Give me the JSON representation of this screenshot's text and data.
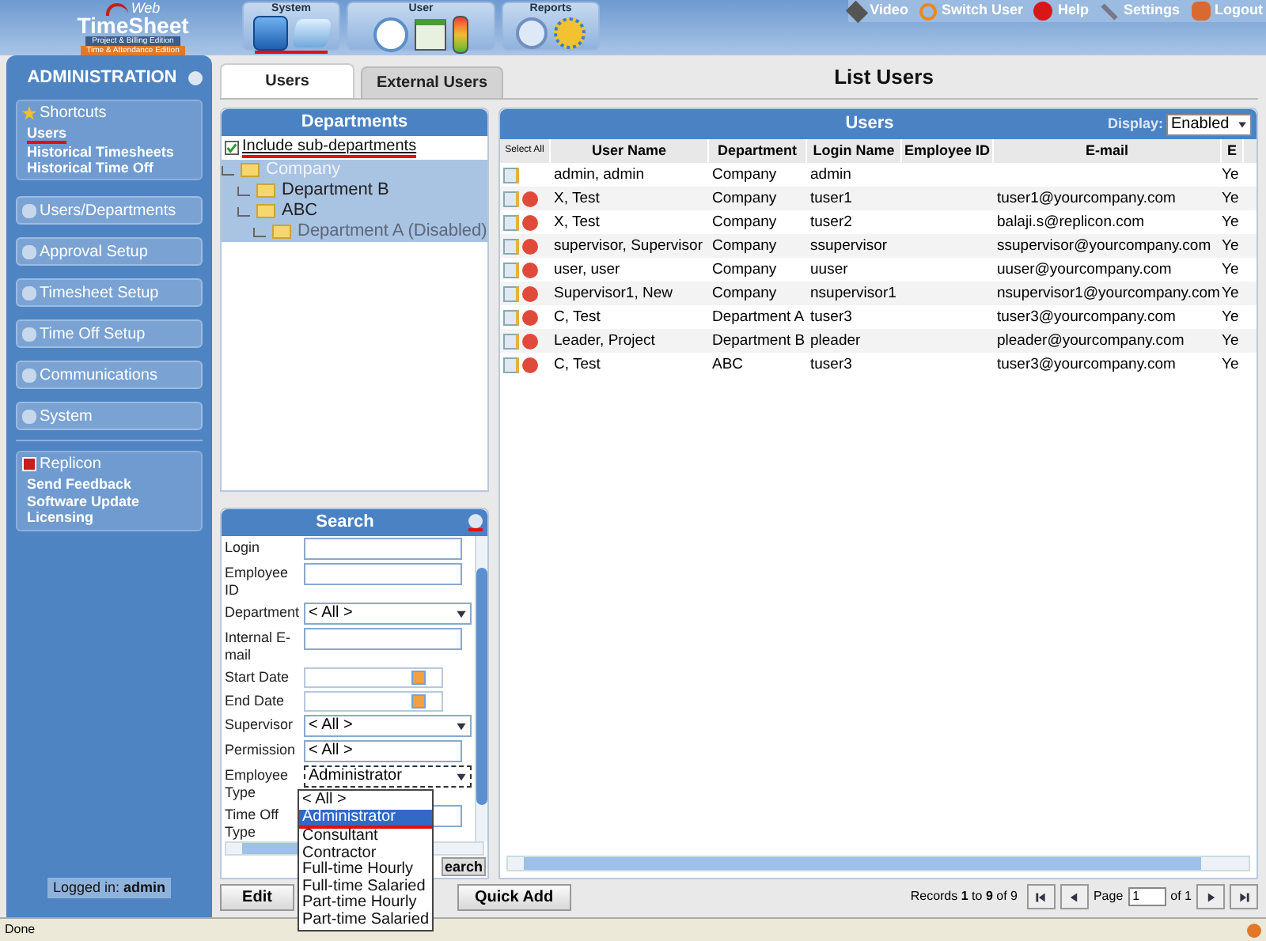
{
  "app": {
    "logo_word": "Web",
    "logo_title": "TimeSheet",
    "edition_1": "Project & Billing Edition",
    "edition_2": "Time & Attendance Edition"
  },
  "toolbar_groups": [
    {
      "label": "System",
      "underlined": true
    },
    {
      "label": "User",
      "underlined": false
    },
    {
      "label": "Reports",
      "underlined": false
    }
  ],
  "top_links": [
    "Video",
    "Switch User",
    "Help",
    "Settings",
    "Logout"
  ],
  "sidebar": {
    "title": "ADMINISTRATION",
    "shortcuts": {
      "title": "Shortcuts",
      "items": [
        {
          "label": "Users",
          "underlined": true
        },
        {
          "label": "Historical Timesheets",
          "underlined": false
        },
        {
          "label": "Historical Time Off",
          "underlined": false
        }
      ]
    },
    "sections": [
      "Users/Departments",
      "Approval Setup",
      "Timesheet Setup",
      "Time Off Setup",
      "Communications",
      "System"
    ],
    "replicon": {
      "title": "Replicon",
      "items": [
        "Send Feedback",
        "Software Update",
        "Licensing"
      ]
    },
    "logged_in": {
      "label": "Logged in:",
      "user": "admin"
    }
  },
  "tabs": [
    {
      "label": "Users",
      "selected": true
    },
    {
      "label": "External Users",
      "selected": false
    }
  ],
  "page_title": "List Users",
  "departments": {
    "title": "Departments",
    "include_sub": {
      "label": "Include sub-departments",
      "checked": true,
      "underlined": true
    },
    "tree": [
      {
        "label": "Company",
        "selected": true,
        "disabled": false,
        "children": [
          {
            "label": "Department B",
            "selected": false,
            "disabled": false
          },
          {
            "label": "ABC",
            "selected": false,
            "disabled": false,
            "children": [
              {
                "label": "Department A (Disabled)",
                "selected": false,
                "disabled": true
              }
            ]
          }
        ]
      }
    ]
  },
  "search": {
    "title": "Search",
    "close_underlined": true,
    "search_button": "earch",
    "fields": [
      {
        "label": "Login",
        "kind": "text"
      },
      {
        "label": "Employee ID",
        "kind": "text"
      },
      {
        "label": "Department",
        "kind": "select",
        "value": "< All >"
      },
      {
        "label": "Internal E-mail",
        "kind": "text"
      },
      {
        "label": "Start Date",
        "kind": "date"
      },
      {
        "label": "End Date",
        "kind": "date"
      },
      {
        "label": "Supervisor",
        "kind": "select",
        "value": "< All >"
      },
      {
        "label": "Permission",
        "kind": "text",
        "value": "< All >"
      },
      {
        "label": "Employee Type",
        "kind": "select",
        "value": "Administrator",
        "expanded": true,
        "options": [
          {
            "label": "< All >",
            "selected": false,
            "underlined": false
          },
          {
            "label": "Administrator",
            "selected": true,
            "underlined": true
          },
          {
            "label": "Consultant",
            "selected": false,
            "underlined": false
          },
          {
            "label": "Contractor",
            "selected": false,
            "underlined": false
          },
          {
            "label": "Full-time Hourly",
            "selected": false,
            "underlined": false
          },
          {
            "label": "Full-time Salaried",
            "selected": false,
            "underlined": false
          },
          {
            "label": "Part-time Hourly",
            "selected": false,
            "underlined": false
          },
          {
            "label": "Part-time Salaried",
            "selected": false,
            "underlined": false
          }
        ]
      },
      {
        "label": "Time Off Type",
        "kind": "text"
      }
    ]
  },
  "users": {
    "title": "Users",
    "display_label": "Display:",
    "display_value": "Enabled",
    "columns": [
      "Select All",
      "User Name",
      "Department",
      "Login Name",
      "Employee ID",
      "E-mail",
      "E"
    ],
    "rows": [
      {
        "deletable": false,
        "user_name": "admin, admin",
        "department": "Company",
        "login_name": "admin",
        "column_7": "Ye"
      },
      {
        "deletable": true,
        "user_name": "X, Test",
        "department": "Company",
        "login_name": "tuser1",
        "email": "tuser1@yourcompany.com",
        "column_7": "Ye"
      },
      {
        "deletable": true,
        "user_name": "X, Test",
        "department": "Company",
        "login_name": "tuser2",
        "email": "balaji.s@replicon.com",
        "column_7": "Ye"
      },
      {
        "deletable": true,
        "user_name": "supervisor, Supervisor",
        "department": "Company",
        "login_name": "ssupervisor",
        "email": "ssupervisor@yourcompany.com",
        "column_7": "Ye"
      },
      {
        "deletable": true,
        "user_name": "user, user",
        "department": "Company",
        "login_name": "uuser",
        "email": "uuser@yourcompany.com",
        "column_7": "Ye"
      },
      {
        "deletable": true,
        "user_name": "Supervisor1, New",
        "department": "Company",
        "login_name": "nsupervisor1",
        "email": "nsupervisor1@yourcompany.com",
        "column_7": "Ye"
      },
      {
        "deletable": true,
        "user_name": "C, Test",
        "department": "Department A",
        "login_name": "tuser3",
        "email": "tuser3@yourcompany.com",
        "column_7": "Ye"
      },
      {
        "deletable": true,
        "user_name": "Leader, Project",
        "department": "Department B",
        "login_name": "pleader",
        "email": "pleader@yourcompany.com",
        "column_7": "Ye"
      },
      {
        "deletable": true,
        "user_name": "C, Test",
        "department": "ABC",
        "login_name": "tuser3",
        "email": "tuser3@yourcompany.com",
        "column_7": "Ye"
      }
    ]
  },
  "footer": {
    "buttons": [
      "Edit",
      "Quick Add"
    ],
    "records": "Records **1** to **9** of 9",
    "page_label": "Page",
    "page_value": "1",
    "page_of": "of 1"
  },
  "status_bar": "Done"
}
